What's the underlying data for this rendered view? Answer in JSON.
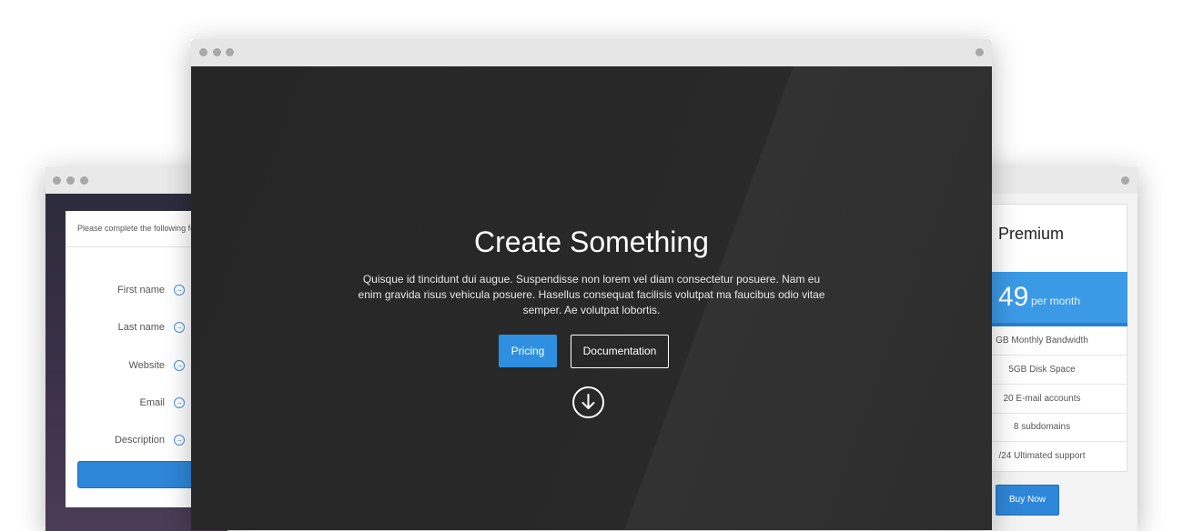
{
  "form_window": {
    "header_text": "Please complete the following fo",
    "fields": [
      {
        "label": "First name"
      },
      {
        "label": "Last name"
      },
      {
        "label": "Website"
      },
      {
        "label": "Email"
      },
      {
        "label": "Description"
      }
    ]
  },
  "main_window": {
    "title": "Create Something",
    "text": "Quisque id tincidunt dui augue. Suspendisse non lorem vel diam consectetur posuere. Nam eu enim gravida risus vehicula posuere. Hasellus consequat facilisis volutpat ma faucibus odio vitae semper. Ae volutpat lobortis.",
    "pricing_button": "Pricing",
    "docs_button": "Documentation",
    "scroll_icon": "arrow-down-circle-icon"
  },
  "pricing_window": {
    "plan": "Premium",
    "price": "49",
    "per": "per month",
    "features": [
      "GB Monthly Bandwidth",
      "5GB Disk Space",
      "20 E-mail accounts",
      "8 subdomains",
      "/24 Ultimated support"
    ],
    "buy_button": "Buy Now"
  },
  "colors": {
    "accent": "#2e86d8",
    "hero_bg": "#282828",
    "titlebar": "#e6e6e6"
  }
}
